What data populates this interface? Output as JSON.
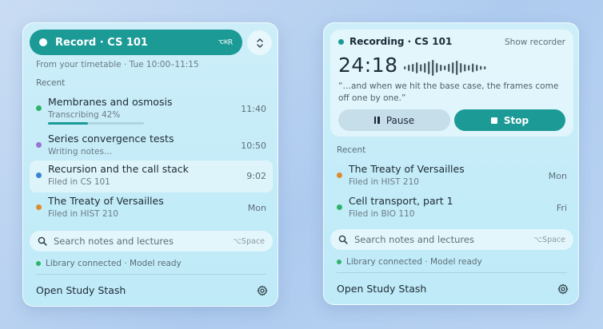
{
  "left": {
    "record": {
      "label": "Record · CS 101",
      "shortcut": "⌥⌘R"
    },
    "timetable": "From your timetable · Tue 10:00–11:15",
    "recent_label": "Recent",
    "items": [
      {
        "title": "Membranes and osmosis",
        "sub": "Transcribing 42%",
        "time": "11:40",
        "color": "#2fb36b",
        "progress": 0.42
      },
      {
        "title": "Series convergence tests",
        "sub": "Writing notes…",
        "time": "10:50",
        "color": "#9a72d6"
      },
      {
        "title": "Recursion and the call stack",
        "sub": "Filed in CS 101",
        "time": "9:02",
        "color": "#3b82d8"
      },
      {
        "title": "The Treaty of Versailles",
        "sub": "Filed in HIST 210",
        "time": "Mon",
        "color": "#e08a2f"
      }
    ],
    "search": {
      "placeholder": "Search notes and lectures",
      "shortcut": "⌥Space"
    },
    "status": "Library connected · Model ready",
    "footer": "Open Study Stash"
  },
  "right": {
    "recording": {
      "title": "Recording · CS 101",
      "show_recorder": "Show recorder",
      "timer": "24:18",
      "quote": "“…and when we hit the base case, the frames come off one by one.”",
      "pause_label": "Pause",
      "stop_label": "Stop"
    },
    "recent_label": "Recent",
    "items": [
      {
        "title": "The Treaty of Versailles",
        "sub": "Filed in HIST 210",
        "time": "Mon",
        "color": "#e08a2f"
      },
      {
        "title": "Cell transport, part 1",
        "sub": "Filed in BIO 110",
        "time": "Fri",
        "color": "#2fb36b"
      }
    ],
    "search": {
      "placeholder": "Search notes and lectures",
      "shortcut": "⌥Space"
    },
    "status": "Library connected · Model ready",
    "footer": "Open Study Stash"
  },
  "colors": {
    "accent": "#1b9a96",
    "status_ok": "#2fb36b"
  }
}
